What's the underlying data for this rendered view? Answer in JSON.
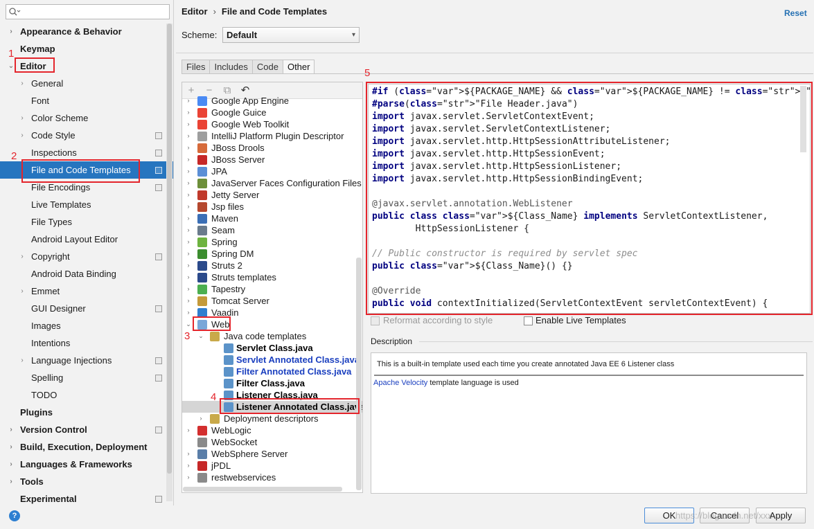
{
  "sidebar": {
    "search_placeholder": "",
    "items": [
      {
        "label": "Appearance & Behavior",
        "level": 0,
        "bold": true,
        "arrow": "›",
        "copy": false
      },
      {
        "label": "Keymap",
        "level": 0,
        "bold": true,
        "arrow": "",
        "copy": false
      },
      {
        "label": "Editor",
        "level": 0,
        "bold": true,
        "arrow": "⌄",
        "copy": false
      },
      {
        "label": "General",
        "level": 1,
        "bold": false,
        "arrow": "›",
        "copy": false
      },
      {
        "label": "Font",
        "level": 1,
        "bold": false,
        "arrow": "",
        "copy": false
      },
      {
        "label": "Color Scheme",
        "level": 1,
        "bold": false,
        "arrow": "›",
        "copy": false
      },
      {
        "label": "Code Style",
        "level": 1,
        "bold": false,
        "arrow": "›",
        "copy": true
      },
      {
        "label": "Inspections",
        "level": 1,
        "bold": false,
        "arrow": "",
        "copy": true
      },
      {
        "label": "File and Code Templates",
        "level": 1,
        "bold": false,
        "arrow": "",
        "copy": true,
        "selected": true
      },
      {
        "label": "File Encodings",
        "level": 1,
        "bold": false,
        "arrow": "",
        "copy": true
      },
      {
        "label": "Live Templates",
        "level": 1,
        "bold": false,
        "arrow": "",
        "copy": false
      },
      {
        "label": "File Types",
        "level": 1,
        "bold": false,
        "arrow": "",
        "copy": false
      },
      {
        "label": "Android Layout Editor",
        "level": 1,
        "bold": false,
        "arrow": "",
        "copy": false
      },
      {
        "label": "Copyright",
        "level": 1,
        "bold": false,
        "arrow": "›",
        "copy": true
      },
      {
        "label": "Android Data Binding",
        "level": 1,
        "bold": false,
        "arrow": "",
        "copy": false
      },
      {
        "label": "Emmet",
        "level": 1,
        "bold": false,
        "arrow": "›",
        "copy": false
      },
      {
        "label": "GUI Designer",
        "level": 1,
        "bold": false,
        "arrow": "",
        "copy": true
      },
      {
        "label": "Images",
        "level": 1,
        "bold": false,
        "arrow": "",
        "copy": false
      },
      {
        "label": "Intentions",
        "level": 1,
        "bold": false,
        "arrow": "",
        "copy": false
      },
      {
        "label": "Language Injections",
        "level": 1,
        "bold": false,
        "arrow": "›",
        "copy": true
      },
      {
        "label": "Spelling",
        "level": 1,
        "bold": false,
        "arrow": "",
        "copy": true
      },
      {
        "label": "TODO",
        "level": 1,
        "bold": false,
        "arrow": "",
        "copy": false
      },
      {
        "label": "Plugins",
        "level": 0,
        "bold": true,
        "arrow": "",
        "copy": false
      },
      {
        "label": "Version Control",
        "level": 0,
        "bold": true,
        "arrow": "›",
        "copy": true
      },
      {
        "label": "Build, Execution, Deployment",
        "level": 0,
        "bold": true,
        "arrow": "›",
        "copy": false
      },
      {
        "label": "Languages & Frameworks",
        "level": 0,
        "bold": true,
        "arrow": "›",
        "copy": false
      },
      {
        "label": "Tools",
        "level": 0,
        "bold": true,
        "arrow": "›",
        "copy": false
      },
      {
        "label": "Experimental",
        "level": 0,
        "bold": true,
        "arrow": "",
        "copy": true
      }
    ]
  },
  "header": {
    "breadcrumb_root": "Editor",
    "breadcrumb_sep": "›",
    "breadcrumb_page": "File and Code Templates",
    "reset_label": "Reset",
    "scheme_label": "Scheme:",
    "scheme_value": "Default"
  },
  "tabs": [
    {
      "label": "Files",
      "active": false
    },
    {
      "label": "Includes",
      "active": false
    },
    {
      "label": "Code",
      "active": false
    },
    {
      "label": "Other",
      "active": true
    }
  ],
  "tree": {
    "toolbar": [
      "+",
      "−",
      "⧉",
      "↶"
    ],
    "rows": [
      {
        "label": "Google App Engine",
        "indent": 0,
        "arrow": "›",
        "icon": "#4a8af4",
        "style": "",
        "clipped": true
      },
      {
        "label": "Google Guice",
        "indent": 0,
        "arrow": "›",
        "icon": "#ea4335",
        "style": ""
      },
      {
        "label": "Google Web Toolkit",
        "indent": 0,
        "arrow": "›",
        "icon": "#ea4335",
        "style": ""
      },
      {
        "label": "IntelliJ Platform Plugin Descriptor",
        "indent": 0,
        "arrow": "›",
        "icon": "#9e9e9e",
        "style": ""
      },
      {
        "label": "JBoss Drools",
        "indent": 0,
        "arrow": "›",
        "icon": "#d66a3a",
        "style": ""
      },
      {
        "label": "JBoss Server",
        "indent": 0,
        "arrow": "›",
        "icon": "#c62828",
        "style": ""
      },
      {
        "label": "JPA",
        "indent": 0,
        "arrow": "›",
        "icon": "#5b8fd6",
        "style": ""
      },
      {
        "label": "JavaServer Faces Configuration Files",
        "indent": 0,
        "arrow": "›",
        "icon": "#6d8f3a",
        "style": ""
      },
      {
        "label": "Jetty Server",
        "indent": 0,
        "arrow": "›",
        "icon": "#c0392b",
        "style": ""
      },
      {
        "label": "Jsp files",
        "indent": 0,
        "arrow": "›",
        "icon": "#b5482e",
        "style": ""
      },
      {
        "label": "Maven",
        "indent": 0,
        "arrow": "›",
        "icon": "#3b6fb6",
        "style": ""
      },
      {
        "label": "Seam",
        "indent": 0,
        "arrow": "›",
        "icon": "#6a7b8c",
        "style": ""
      },
      {
        "label": "Spring",
        "indent": 0,
        "arrow": "›",
        "icon": "#6db33f",
        "style": ""
      },
      {
        "label": "Spring DM",
        "indent": 0,
        "arrow": "›",
        "icon": "#3c8d2f",
        "style": ""
      },
      {
        "label": "Struts 2",
        "indent": 0,
        "arrow": "›",
        "icon": "#2b4a8b",
        "style": ""
      },
      {
        "label": "Struts templates",
        "indent": 0,
        "arrow": "›",
        "icon": "#2b4a8b",
        "style": ""
      },
      {
        "label": "Tapestry",
        "indent": 0,
        "arrow": "›",
        "icon": "#4caf50",
        "style": ""
      },
      {
        "label": "Tomcat Server",
        "indent": 0,
        "arrow": "›",
        "icon": "#c49a3a",
        "style": ""
      },
      {
        "label": "Vaadin",
        "indent": 0,
        "arrow": "›",
        "icon": "#2f7fd0",
        "style": ""
      },
      {
        "label": "Web",
        "indent": 0,
        "arrow": "⌄",
        "icon": "#7aa7d8",
        "style": ""
      },
      {
        "label": "Java code templates",
        "indent": 1,
        "arrow": "⌄",
        "icon": "#c9a94a",
        "style": ""
      },
      {
        "label": "Servlet Class.java",
        "indent": 2,
        "arrow": "",
        "icon": "#5b93c9",
        "style": "black"
      },
      {
        "label": "Servlet Annotated Class.java",
        "indent": 2,
        "arrow": "",
        "icon": "#5b93c9",
        "style": "blue"
      },
      {
        "label": "Filter Annotated Class.java",
        "indent": 2,
        "arrow": "",
        "icon": "#5b93c9",
        "style": "blue"
      },
      {
        "label": "Filter Class.java",
        "indent": 2,
        "arrow": "",
        "icon": "#5b93c9",
        "style": "black"
      },
      {
        "label": "Listener Class.java",
        "indent": 2,
        "arrow": "",
        "icon": "#5b93c9",
        "style": "black"
      },
      {
        "label": "Listener Annotated Class.java",
        "indent": 2,
        "arrow": "",
        "icon": "#5b93c9",
        "style": "black",
        "selected": true
      },
      {
        "label": "Deployment descriptors",
        "indent": 1,
        "arrow": "›",
        "icon": "#c9a94a",
        "style": ""
      },
      {
        "label": "WebLogic",
        "indent": 0,
        "arrow": "›",
        "icon": "#d32f2f",
        "style": ""
      },
      {
        "label": "WebSocket",
        "indent": 0,
        "arrow": "",
        "icon": "#8a8a8a",
        "style": ""
      },
      {
        "label": "WebSphere Server",
        "indent": 0,
        "arrow": "›",
        "icon": "#5a7ea8",
        "style": ""
      },
      {
        "label": "jPDL",
        "indent": 0,
        "arrow": "›",
        "icon": "#c62828",
        "style": ""
      },
      {
        "label": "restwebservices",
        "indent": 0,
        "arrow": "›",
        "icon": "#8a8a8a",
        "style": ""
      }
    ]
  },
  "editor": {
    "lines": [
      "#if (${PACKAGE_NAME} && ${PACKAGE_NAME} != \"\")package ${PACKAGE_NAME};#end",
      "#parse(\"File Header.java\")",
      "import javax.servlet.ServletContextEvent;",
      "import javax.servlet.ServletContextListener;",
      "import javax.servlet.http.HttpSessionAttributeListener;",
      "import javax.servlet.http.HttpSessionEvent;",
      "import javax.servlet.http.HttpSessionListener;",
      "import javax.servlet.http.HttpSessionBindingEvent;",
      "",
      "@javax.servlet.annotation.WebListener",
      "public class ${Class_Name} implements ServletContextListener,",
      "        HttpSessionListener {",
      "",
      "// Public constructor is required by servlet spec",
      "public ${Class_Name}() {}",
      "",
      "@Override",
      "public void contextInitialized(ServletContextEvent servletContextEvent) {"
    ]
  },
  "options": {
    "reformat_label": "Reformat according to style",
    "live_templates_label": "Enable Live Templates"
  },
  "description": {
    "label": "Description",
    "text": "This is a built-in template used each time you create annotated Java EE 6 Listener class",
    "link": "Apache Velocity",
    "suffix": " template language is used"
  },
  "footer": {
    "help": "?",
    "ok": "OK",
    "cancel": "Cancel",
    "apply": "Apply",
    "watermark": "https://blog.csdn.net/xxx"
  },
  "annotations": [
    "1",
    "2",
    "3",
    "4",
    "5"
  ],
  "colors": {
    "selection": "#2675bf",
    "annotation_red": "#e4252c",
    "keyword": "#000080",
    "variable": "#1a3fbf",
    "string": "#067d17"
  }
}
